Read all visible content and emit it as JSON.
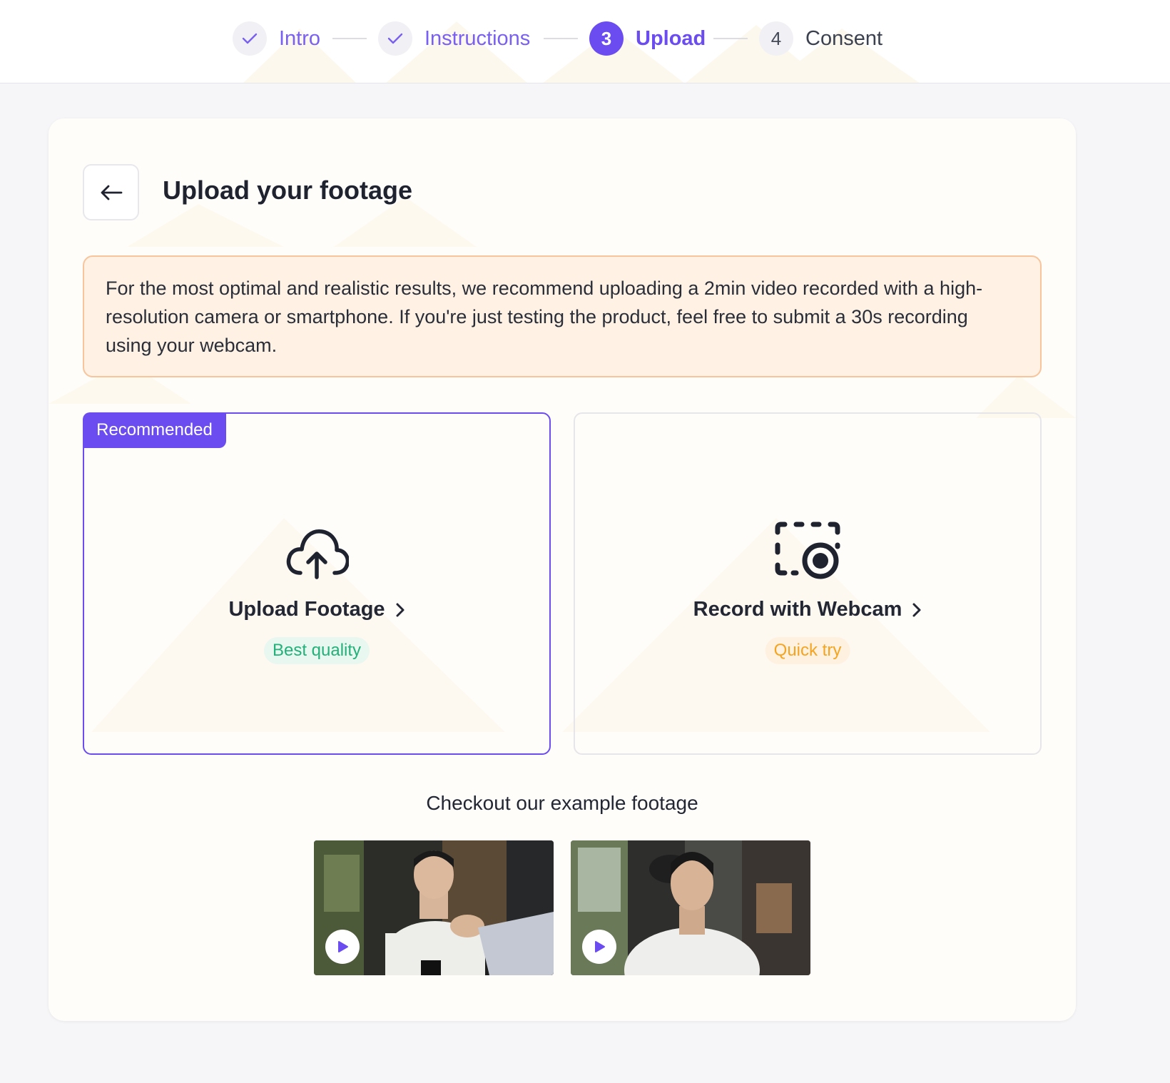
{
  "stepper": {
    "steps": [
      {
        "number": "",
        "label": "Intro",
        "state": "done"
      },
      {
        "number": "",
        "label": "Instructions",
        "state": "done"
      },
      {
        "number": "3",
        "label": "Upload",
        "state": "active"
      },
      {
        "number": "4",
        "label": "Consent",
        "state": "todo"
      }
    ]
  },
  "header": {
    "title": "Upload your footage",
    "back_icon": "arrow-left-icon"
  },
  "notice": {
    "text": "For the most optimal and realistic results, we recommend uploading a 2min video recorded with a high-resolution camera or smartphone. If you're just testing the product, feel free to submit a 30s recording using your webcam."
  },
  "options": {
    "upload": {
      "badge": "Recommended",
      "icon": "cloud-upload-icon",
      "title": "Upload Footage",
      "tag": "Best quality"
    },
    "webcam": {
      "icon": "record-screen-icon",
      "title": "Record with Webcam",
      "tag": "Quick try"
    }
  },
  "examples": {
    "title": "Checkout our example footage",
    "videos": [
      {
        "icon": "play-icon"
      },
      {
        "icon": "play-icon"
      }
    ]
  },
  "colors": {
    "accent": "#6a4cf0",
    "notice_bg": "#fff1e4",
    "notice_border": "#f8c49c",
    "best_quality": "#23b07a",
    "quick_try": "#f5a422"
  }
}
